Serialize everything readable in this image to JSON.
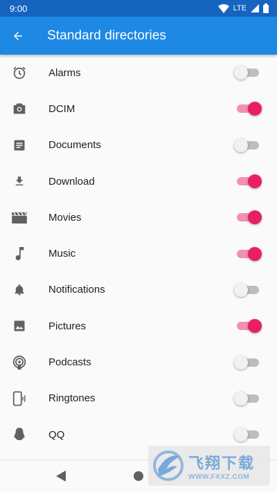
{
  "status_bar": {
    "time": "9:00",
    "network": "LTE"
  },
  "app_bar": {
    "title": "Standard directories"
  },
  "directories": [
    {
      "label": "Alarms",
      "icon": "alarm-clock-icon",
      "enabled": false
    },
    {
      "label": "DCIM",
      "icon": "camera-icon",
      "enabled": true
    },
    {
      "label": "Documents",
      "icon": "document-icon",
      "enabled": false
    },
    {
      "label": "Download",
      "icon": "download-icon",
      "enabled": true
    },
    {
      "label": "Movies",
      "icon": "movie-clapper-icon",
      "enabled": true
    },
    {
      "label": "Music",
      "icon": "music-note-icon",
      "enabled": true
    },
    {
      "label": "Notifications",
      "icon": "bell-icon",
      "enabled": false
    },
    {
      "label": "Pictures",
      "icon": "image-icon",
      "enabled": true
    },
    {
      "label": "Podcasts",
      "icon": "podcast-icon",
      "enabled": false
    },
    {
      "label": "Ringtones",
      "icon": "phone-ringtone-icon",
      "enabled": false
    },
    {
      "label": "QQ",
      "icon": "qq-penguin-icon",
      "enabled": false
    }
  ],
  "colors": {
    "app_bar": "#1e88e5",
    "status_bar": "#1565c0",
    "switch_on_thumb": "#e91e63",
    "switch_on_track": "#f48fb1",
    "icon": "#616161"
  },
  "watermark": {
    "text_cn": "飞翔下载",
    "url": "WWW.FXXZ.COM"
  }
}
